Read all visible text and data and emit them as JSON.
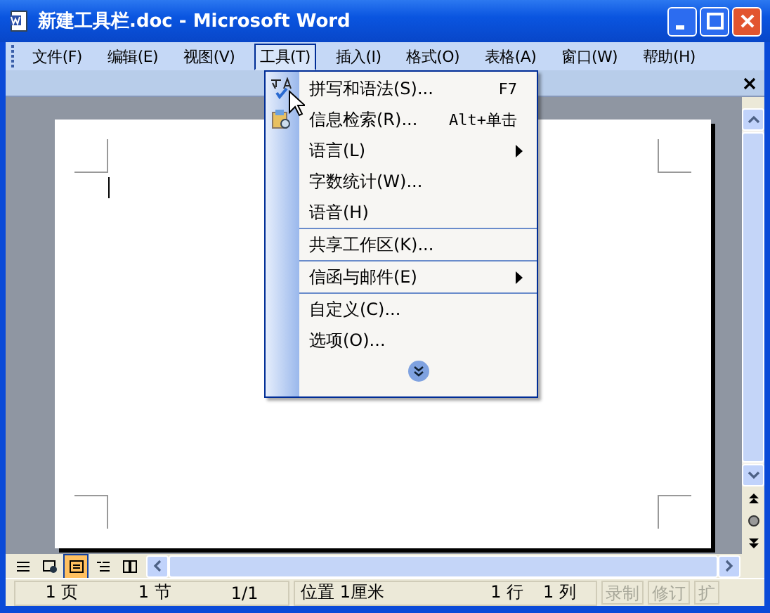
{
  "window": {
    "title": "新建工具栏.doc - Microsoft Word"
  },
  "menu_bar": [
    {
      "label": "文件(F)",
      "selected": false
    },
    {
      "label": "编辑(E)",
      "selected": false
    },
    {
      "label": "视图(V)",
      "selected": false
    },
    {
      "label": "工具(T)",
      "selected": true
    },
    {
      "label": "插入(I)",
      "selected": false
    },
    {
      "label": "格式(O)",
      "selected": false
    },
    {
      "label": "表格(A)",
      "selected": false
    },
    {
      "label": "窗口(W)",
      "selected": false
    },
    {
      "label": "帮助(H)",
      "selected": false
    }
  ],
  "tools_menu": {
    "items": [
      {
        "label": "拼写和语法(S)...",
        "shortcut": "F7",
        "submenu": false,
        "separator_above": false
      },
      {
        "label": "信息检索(R)...",
        "shortcut": "Alt+单击",
        "submenu": false,
        "separator_above": false
      },
      {
        "label": "语言(L)",
        "submenu": true,
        "separator_above": false
      },
      {
        "label": "字数统计(W)...",
        "submenu": false,
        "separator_above": false
      },
      {
        "label": "语音(H)",
        "submenu": false,
        "separator_above": false
      },
      {
        "label": "共享工作区(K)...",
        "submenu": false,
        "separator_above": true
      },
      {
        "label": "信函与邮件(E)",
        "submenu": true,
        "separator_above": true
      },
      {
        "label": "自定义(C)...",
        "submenu": false,
        "separator_above": true
      },
      {
        "label": "选项(O)...",
        "submenu": false,
        "separator_above": false
      }
    ]
  },
  "status_bar": [
    {
      "text": "1 页",
      "disabled": false
    },
    {
      "text": "1 节",
      "disabled": false
    },
    {
      "text": "1/1",
      "disabled": false
    },
    {
      "text": "位置 1厘米",
      "disabled": false
    },
    {
      "text": "1 行",
      "disabled": false
    },
    {
      "text": "1 列",
      "disabled": false
    },
    {
      "text": "录制",
      "disabled": true
    },
    {
      "text": "修订",
      "disabled": true
    },
    {
      "text": "扩",
      "disabled": true
    }
  ]
}
